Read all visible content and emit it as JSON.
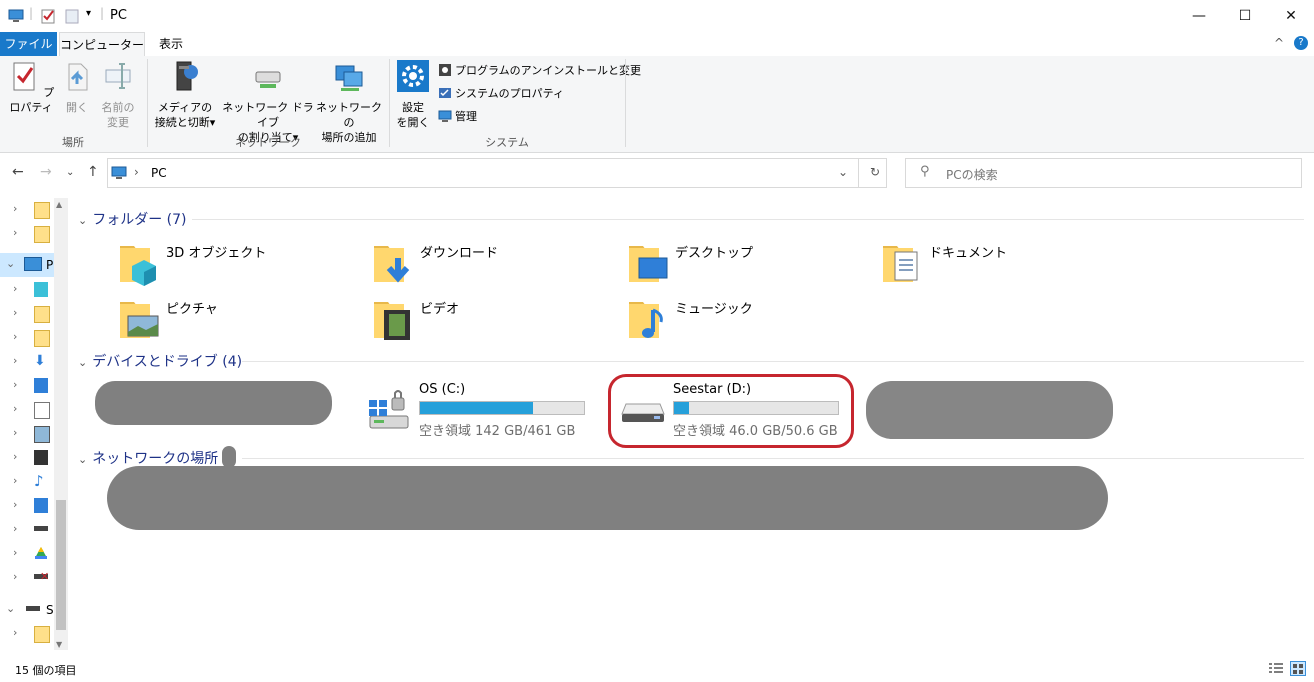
{
  "window": {
    "title": "PC",
    "controls": [
      "—",
      "☐",
      "✕"
    ]
  },
  "ribbon": {
    "tabs": [
      "ファイル",
      "コンピューター",
      "表示"
    ],
    "location_group": {
      "label": "場所",
      "properties_label": "プロパティ",
      "open_label": "開く",
      "rename_line1": "名前の",
      "rename_line2": "変更"
    },
    "network_group": {
      "label": "ネットワーク",
      "media_line1": "メディアの",
      "media_line2": "接続と切断",
      "map_line1": "ネットワーク ドライブ",
      "map_line2": "の割り当て",
      "add_line1": "ネットワークの",
      "add_line2": "場所の追加"
    },
    "system_group": {
      "label": "システム",
      "settings_line1": "設定",
      "settings_line2": "を開く",
      "uninstall_label": "プログラムのアンインストールと変更",
      "sysprops_label": "システムのプロパティ",
      "manage_label": "管理"
    },
    "dropdown_glyph": "▾",
    "collapse_glyph": "^",
    "help_glyph": "?"
  },
  "address_bar": {
    "path": "PC",
    "separator": "›",
    "search_placeholder": "PCの検索"
  },
  "nav_pane": {
    "pc_label": "P",
    "s_label": "S"
  },
  "content": {
    "folders_header": "フォルダー (7)",
    "folders": [
      {
        "name": "3D オブジェクト",
        "icon": "3d-objects-folder-icon"
      },
      {
        "name": "ダウンロード",
        "icon": "downloads-folder-icon"
      },
      {
        "name": "デスクトップ",
        "icon": "desktop-folder-icon"
      },
      {
        "name": "ドキュメント",
        "icon": "documents-folder-icon"
      },
      {
        "name": "ピクチャ",
        "icon": "pictures-folder-icon"
      },
      {
        "name": "ビデオ",
        "icon": "videos-folder-icon"
      },
      {
        "name": "ミュージック",
        "icon": "music-folder-icon"
      }
    ],
    "devices_header": "デバイスとドライブ (4)",
    "drives": [
      {
        "name": "OS (C:)",
        "free_text": "空き領域 142 GB/461 GB",
        "used_fraction": 0.69
      },
      {
        "name": "Seestar (D:)",
        "free_text": "空き領域 46.0 GB/50.6 GB",
        "used_fraction": 0.09
      }
    ],
    "network_header": "ネットワークの場所 ("
  },
  "status_bar": {
    "item_count": "15 個の項目"
  },
  "colors": {
    "accent": "#1979ca",
    "bar_fill": "#26a0da",
    "highlight": "#c6262e",
    "redaction": "#808080"
  }
}
